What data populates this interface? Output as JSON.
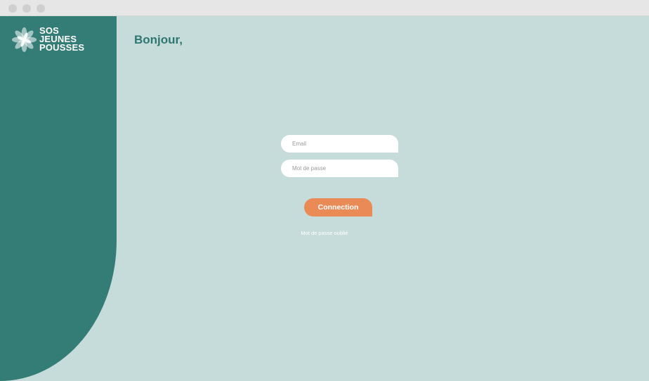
{
  "window": {
    "controls": [
      "close",
      "minimize",
      "zoom"
    ]
  },
  "brand": {
    "logo_icon": "flower-icon",
    "line1": "SOS",
    "line2": "JEUNES",
    "line3": "POUSSES"
  },
  "main": {
    "greeting": "Bonjour,"
  },
  "login_form": {
    "email_placeholder": "Email",
    "password_placeholder": "Mot de passe",
    "submit_label": "Connection",
    "forgot_password_link": "Mot de passe oublié"
  },
  "colors": {
    "background": "#c6dcda",
    "sidebar": "#347d76",
    "heading": "#2e7670",
    "button": "#ea8a56",
    "input": "#ffffff"
  }
}
